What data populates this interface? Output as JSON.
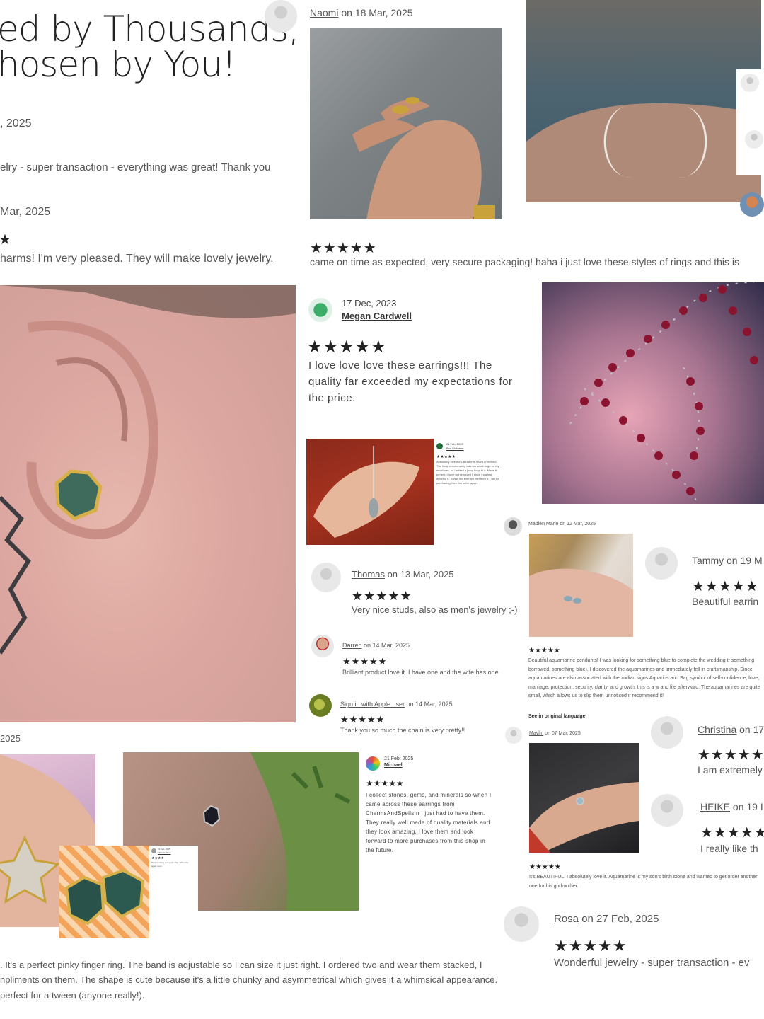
{
  "headline": {
    "line1": "ed by Thousands,",
    "line2": "hosen by You!"
  },
  "top_left": {
    "date1": ", 2025",
    "text1": "elry - super transaction - everything was great! Thank you",
    "date2": "Mar, 2025",
    "star": "★",
    "text2": "harms! I'm very pleased. They will make lovely jewelry."
  },
  "naomi": {
    "name": "Naomi",
    "date": " on 18 Mar, 2025",
    "stars": "★★★★★",
    "text": "came on time as expected, very secure packaging! haha i just love these styles of rings and this is"
  },
  "megan": {
    "date": "17 Dec, 2023",
    "name": "Megan Cardwell",
    "stars": "★★★★★",
    "text": "I love love love these earrings!!! The quality far exceeded my expectations for the price."
  },
  "mini_review": {
    "date": "24 Feb, 2025",
    "name": "Bec Shildams",
    "stars": "★★★★★",
    "text": "Absolutely love the Labradorite shard I received. The hoop unfortunately was too small to go on my necklaces, so I added a jump hoop to it. Made it perfect. I have not removed it since I started wearing it.. loving the energy I feel from it. I will be purchasing from this seller again."
  },
  "thomas": {
    "name": "Thomas",
    "date": " on 13 Mar, 2025",
    "stars": "★★★★★",
    "text": "Very nice studs, also as men's jewelry ;-)"
  },
  "darren": {
    "name": "Darren",
    "date": " on 14 Mar, 2025",
    "stars": "★★★★★",
    "text": "Brilliant product love it. I have one and the wife has one"
  },
  "apple": {
    "name": "Sign in with Apple user",
    "date": " on 14 Mar, 2025",
    "stars": "★★★★★",
    "text": "Thank you so much the chain is very pretty!!"
  },
  "madlen": {
    "name": "Madlen Marie",
    "date": " on 12 Mar, 2025",
    "stars": "★★★★★",
    "text": "Beautiful aquamarine pendants! I was looking for something blue to complete the wedding tr something borrowed, something blue). I discovered the aquamarines and immediately fell in craftsmanship. Since aquamarines are also associated with the zodiac signs Aquarius and Sag symbol of self-confidence, love, marriage, protection, security, clarity, and growth, this is a w and life afterward. The aquamarines are quite small, which allows us to slip them unnoticed ir recommend it!",
    "link": "See in original language"
  },
  "tammy": {
    "name": "Tammy",
    "date": " on 19 M",
    "stars": "★★★★★",
    "text": "Beautiful earrin"
  },
  "christina": {
    "name": "Christina",
    "date": " on 17",
    "stars": "★★★★★",
    "text": "I am extremely"
  },
  "heike": {
    "name": "HEIKE",
    "date": " on 19 I",
    "stars": "★★★★★",
    "text": "I really like th"
  },
  "maylin": {
    "name": "Maylin",
    "date": " on 07 Mar, 2025",
    "stars": "★★★★★",
    "text": "It's BEAUTIFUL. I absolutely love it. Aquamarine is my son's birth stone and wanted to get order another one for his godmother."
  },
  "michael": {
    "date": "21 Feb, 2025",
    "name": "Michael",
    "stars": "★★★★★",
    "text": "I collect stones, gems, and minerals so when I came across these earrings from CharmsAndSpellsIn I just had to have them. They really well made of quality materials and they look amazing. I love them and look forward to more purchases from this shop in the future."
  },
  "tiny_review": {
    "date": "21 Feb, 2025",
    "name": "Mihaela Jianu",
    "stars": "★★★★",
    "text": "Perfect sizing and quick ship. Will order again soon."
  },
  "rosa": {
    "name": "Rosa",
    "date": " on 27 Feb, 2025",
    "stars": "★★★★★",
    "text": "Wonderful jewelry - super transaction - ev"
  },
  "bottom_left": {
    "date": "2025",
    "line1": ". It's a perfect pinky finger ring. The band is adjustable so I can size it just right. I ordered two and wear them stacked, I",
    "line2": "npliments on them. The shape is cute because it's a little chunky and asymmetrical which gives it a whimsical appearance.",
    "line3": "perfect for a tween (anyone really!)."
  },
  "colors": {
    "text": "#555555",
    "dark": "#222222",
    "link": "#333333"
  }
}
